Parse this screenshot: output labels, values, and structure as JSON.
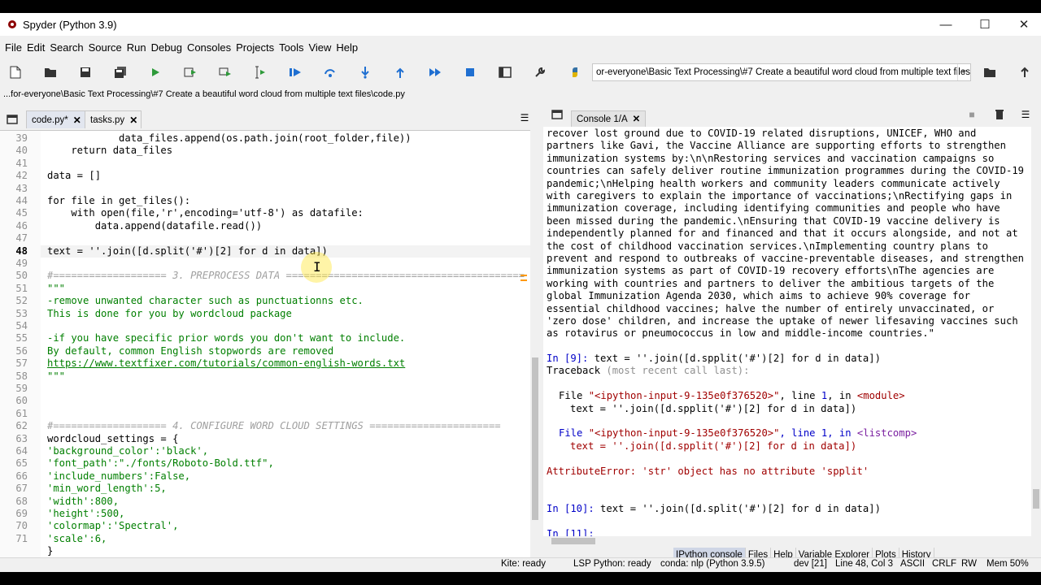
{
  "window": {
    "title": "Spyder (Python 3.9)",
    "minimize": "—",
    "maximize": "☐",
    "close": "✕"
  },
  "menu": [
    "File",
    "Edit",
    "Search",
    "Source",
    "Run",
    "Debug",
    "Consoles",
    "Projects",
    "Tools",
    "View",
    "Help"
  ],
  "toolbar": {
    "working_dir": "or-everyone\\Basic Text Processing\\#7 Create a beautiful word cloud from multiple text files"
  },
  "editor": {
    "file_path": "...for-everyone\\Basic Text Processing\\#7 Create a beautiful word cloud from multiple text files\\code.py",
    "tabs": [
      {
        "label": "code.py*",
        "active": true
      },
      {
        "label": "tasks.py",
        "active": false
      }
    ],
    "current_line": 48,
    "lines": [
      {
        "n": "39",
        "code": "            data_files.append(os.path.join(root_folder,file))"
      },
      {
        "n": "40",
        "code": "    return data_files"
      },
      {
        "n": "41",
        "code": ""
      },
      {
        "n": "42",
        "code": "data = []"
      },
      {
        "n": "43",
        "code": ""
      },
      {
        "n": "44",
        "code": "for file in get_files():"
      },
      {
        "n": "45",
        "code": "    with open(file,'r',encoding='utf-8') as datafile:"
      },
      {
        "n": "46",
        "code": "        data.append(datafile.read())"
      },
      {
        "n": "47",
        "code": ""
      },
      {
        "n": "48",
        "code": "text = ''.join([d.split('#')[2] for d in data])"
      },
      {
        "n": "49",
        "code": ""
      },
      {
        "n": "50",
        "code": "#=================== 3. PREPROCESS DATA ========================================"
      },
      {
        "n": "51",
        "code": "\"\"\""
      },
      {
        "n": "52",
        "code": "-remove unwanted character such as punctuationns etc."
      },
      {
        "n": "53",
        "code": "This is done for you by wordcloud package"
      },
      {
        "n": "54",
        "code": ""
      },
      {
        "n": "55",
        "code": "-if you have specific prior words you don't want to include."
      },
      {
        "n": "56",
        "code": "By default, common English stopwords are removed"
      },
      {
        "n": "57",
        "code": "https://www.textfixer.com/tutorials/common-english-words.txt"
      },
      {
        "n": "58",
        "code": "\"\"\""
      },
      {
        "n": "59",
        "code": ""
      },
      {
        "n": "60",
        "code": ""
      },
      {
        "n": "61",
        "code": ""
      },
      {
        "n": "62",
        "code": "#=================== 4. CONFIGURE WORD CLOUD SETTINGS ======================"
      },
      {
        "n": "63",
        "code": "wordcloud_settings = {"
      },
      {
        "n": "64",
        "code": "'background_color':'black',"
      },
      {
        "n": "65",
        "code": "'font_path':\"./fonts/Roboto-Bold.ttf\","
      },
      {
        "n": "66",
        "code": "'include_numbers':False,"
      },
      {
        "n": "67",
        "code": "'min_word_length':5,"
      },
      {
        "n": "68",
        "code": "'width':800,"
      },
      {
        "n": "69",
        "code": "'height':500,"
      },
      {
        "n": "70",
        "code": "'colormap':'Spectral',"
      },
      {
        "n": "71",
        "code": "'scale':6,"
      },
      {
        "n": "",
        "code": "}"
      }
    ]
  },
  "console": {
    "tab_label": "Console 1/A",
    "output_lines": [
      "recover lost ground due to COVID-19 related disruptions, UNICEF, WHO and",
      "partners like Gavi, the Vaccine Alliance are supporting efforts to strengthen",
      "immunization systems by:\\n\\nRestoring services and vaccination campaigns so",
      "countries can safely deliver routine immunization programmes during the COVID-19",
      "pandemic;\\nHelping health workers and community leaders communicate actively",
      "with caregivers to explain the importance of vaccinations;\\nRectifying gaps in",
      "immunization coverage, including identifying communities and people who have",
      "been missed during the pandemic.\\nEnsuring that COVID-19 vaccine delivery is",
      "independently planned for and financed and that it occurs alongside, and not at",
      "the cost of childhood vaccination services.\\nImplementing country plans to",
      "prevent and respond to outbreaks of vaccine-preventable diseases, and strengthen",
      "immunization systems as part of COVID-19 recovery efforts\\nThe agencies are",
      "working with countries and partners to deliver the ambitious targets of the",
      "global Immunization Agenda 2030, which aims to achieve 90% coverage for",
      "essential childhood vaccines; halve the number of entirely unvaccinated, or",
      "'zero dose' children, and increase the uptake of newer lifesaving vaccines such",
      "as rotavirus or pneumococcus in low and middle-income countries.\""
    ],
    "in9_prompt": "In [9]:",
    "in9_code": " text = ''.join([d.spplit('#')[2] for d in data])",
    "traceback_head": "Traceback ",
    "traceback_note": "(most recent call last):",
    "frame1_file": "File ",
    "frame1_name": "\"<ipython-input-9-135e0f376520>\"",
    "frame1_line": ", line ",
    "frame1_num": "1",
    "frame1_in": ", in ",
    "frame1_mod": "<module>",
    "frame1_code": "text = ''.join([d.spplit('#')[2] for d in data])",
    "frame2_mod": "<listcomp>",
    "frame2_code": "text = ''.join([d.spplit('#')[2] for d in data])",
    "error": "AttributeError: 'str' object has no attribute 'spplit'",
    "in10_prompt": "In [10]:",
    "in10_code": " text = ''.join([d.split('#')[2] for d in data])",
    "in11_prompt": "In [11]:"
  },
  "pane_tabs": [
    "IPython console",
    "Files",
    "Help",
    "Variable Explorer",
    "Plots",
    "History"
  ],
  "status": {
    "kite": "Kite: ready",
    "lsp": "LSP Python: ready",
    "conda": "conda: nlp (Python 3.9.5)",
    "git": "dev [21]",
    "position": "Line 48, Col 3",
    "encoding": "ASCII",
    "eol": "CRLF",
    "rw": "RW",
    "mem": "Mem 50%"
  }
}
